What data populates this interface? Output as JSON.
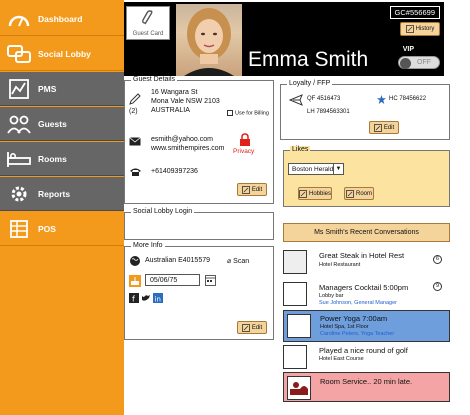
{
  "sidebar": {
    "items": [
      {
        "label": "Dashboard"
      },
      {
        "label": "Social Lobby"
      },
      {
        "label": "PMS"
      },
      {
        "label": "Guests"
      },
      {
        "label": "Rooms"
      },
      {
        "label": "Reports"
      },
      {
        "label": "POS"
      }
    ]
  },
  "header": {
    "guest_card_label": "Guest Card",
    "name": "Emma Smith",
    "guest_id": "GC#556699",
    "history_label": "History",
    "vip_label": "VIP",
    "vip_state": "OFF"
  },
  "guest_details": {
    "title": "Guest Details",
    "address_count": "(2)",
    "address_line1": "16 Wangara St",
    "address_line2": "Mona Vale NSW 2103",
    "address_line3": "AUSTRALIA",
    "use_for_billing": "Use for Billing",
    "email1": "esmith@yahoo.com",
    "email2": "www.smithempires.com",
    "privacy_label": "Privacy",
    "phone": "+61409397236",
    "edit_label": "Edit"
  },
  "social_lobby": {
    "title": "Social Lobby Login"
  },
  "more_info": {
    "title": "More Info",
    "nationality": "Australian E4015579",
    "scan_label": "Scan",
    "dob": "05/06/75",
    "edit_label": "Edit"
  },
  "loyalty": {
    "title": "Loyalty / FFP",
    "qf": "QF 4516473",
    "hc": "HC 78456622",
    "lh": "LH 7894563301",
    "edit_label": "Edit"
  },
  "likes": {
    "title": "Likes",
    "selected": "Boston Herald",
    "hobbies_label": "Hobbies",
    "room_label": "Room"
  },
  "conversations": {
    "header": "Ms Smith's Recent Conversations",
    "items": [
      {
        "title": "Great Steak in Hotel Rest",
        "sub": "Hotel Restaurant",
        "badge": "6"
      },
      {
        "title": "Managers Cocktail 5:00pm",
        "sub": "Lobby bar",
        "sub2": "Sue Johnson, General Manager",
        "badge": "9"
      },
      {
        "title": "Power Yoga 7:00am",
        "sub": "Hotel Spa, 1st Floor",
        "sub2": "Caroline Peters, Yoga Teacher"
      },
      {
        "title": "Played a nice round of golf",
        "sub": "Hotel East Course"
      },
      {
        "title": "Room Service.. 20 min late."
      }
    ]
  },
  "colors": {
    "sidebar": "#f39a1c",
    "nav_dark": "#666666",
    "accent_button": "#f4d49a",
    "likes_bg": "#fde3a0",
    "conv_blue": "#6f9edc",
    "conv_red": "#f4a4a4",
    "privacy": "#e0201c"
  }
}
